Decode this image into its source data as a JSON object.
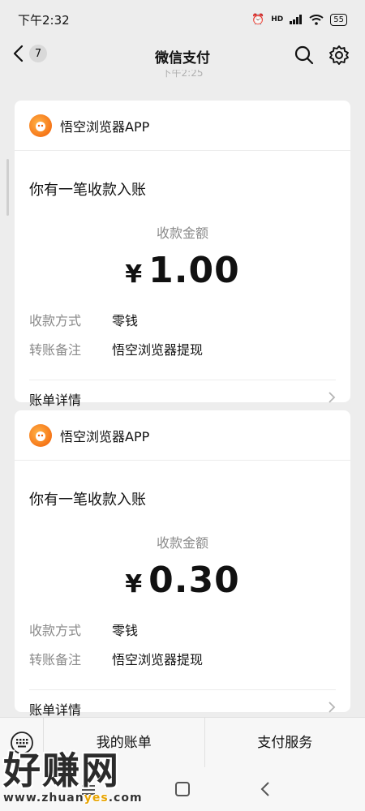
{
  "status_bar": {
    "time": "下午2:32",
    "network": "HD",
    "battery": "55"
  },
  "nav": {
    "title": "微信支付",
    "unread_count": "7"
  },
  "timestamp_partial": "下午2:25",
  "cards": [
    {
      "app_name": "悟空浏览器APP",
      "title": "你有一笔收款入账",
      "amount_label": "收款金额",
      "currency": "¥",
      "amount": "1.00",
      "rows": [
        {
          "key": "收款方式",
          "value": "零钱"
        },
        {
          "key": "转账备注",
          "value": "悟空浏览器提现"
        }
      ],
      "bill_label": "账单详情"
    },
    {
      "app_name": "悟空浏览器APP",
      "title": "你有一笔收款入账",
      "amount_label": "收款金额",
      "currency": "¥",
      "amount": "0.30",
      "rows": [
        {
          "key": "收款方式",
          "value": "零钱"
        },
        {
          "key": "转账备注",
          "value": "悟空浏览器提现"
        }
      ],
      "bill_label": "账单详情"
    }
  ],
  "bottom_menu": {
    "my_bill": "我的账单",
    "pay_service": "支付服务"
  },
  "watermark": {
    "text": "好赚网",
    "url_pre": "www.zhuan",
    "url_hl": "yes",
    "url_post": ".com"
  },
  "icons": {
    "back": "chevron-left-icon",
    "search": "search-icon",
    "settings": "gear-icon",
    "keyboard": "keyboard-icon",
    "chevron": "chevron-right-icon"
  }
}
